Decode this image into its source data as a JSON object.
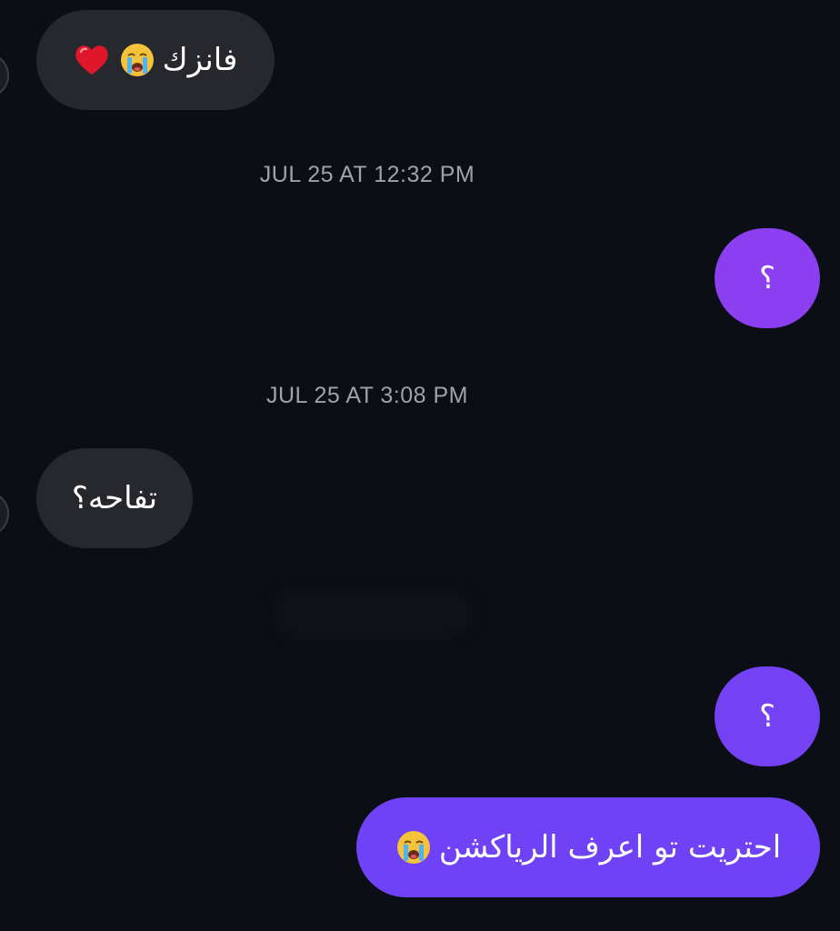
{
  "messages": [
    {
      "id": "m1",
      "direction": "incoming",
      "text": "فانزك",
      "emojis": [
        "crying-face-emoji",
        "red-heart-emoji"
      ]
    },
    {
      "id": "m2",
      "direction": "outgoing",
      "text": "؟"
    },
    {
      "id": "m3",
      "direction": "incoming",
      "text": "تفاحه؟"
    },
    {
      "id": "m4",
      "direction": "outgoing",
      "text": "؟"
    },
    {
      "id": "m5",
      "direction": "outgoing",
      "text": "احتريت تو اعرف الرياكشن",
      "emojis": [
        "crying-face-emoji"
      ]
    }
  ],
  "timestamps": [
    "JUL 25 AT 12:32 PM",
    "JUL 25 AT 3:08 PM"
  ],
  "colors": {
    "background": "#0b0e15",
    "incoming_bubble": "#26282d",
    "outgoing_bubble": "#7a3ff2",
    "timestamp_text": "#9ea2aa"
  }
}
